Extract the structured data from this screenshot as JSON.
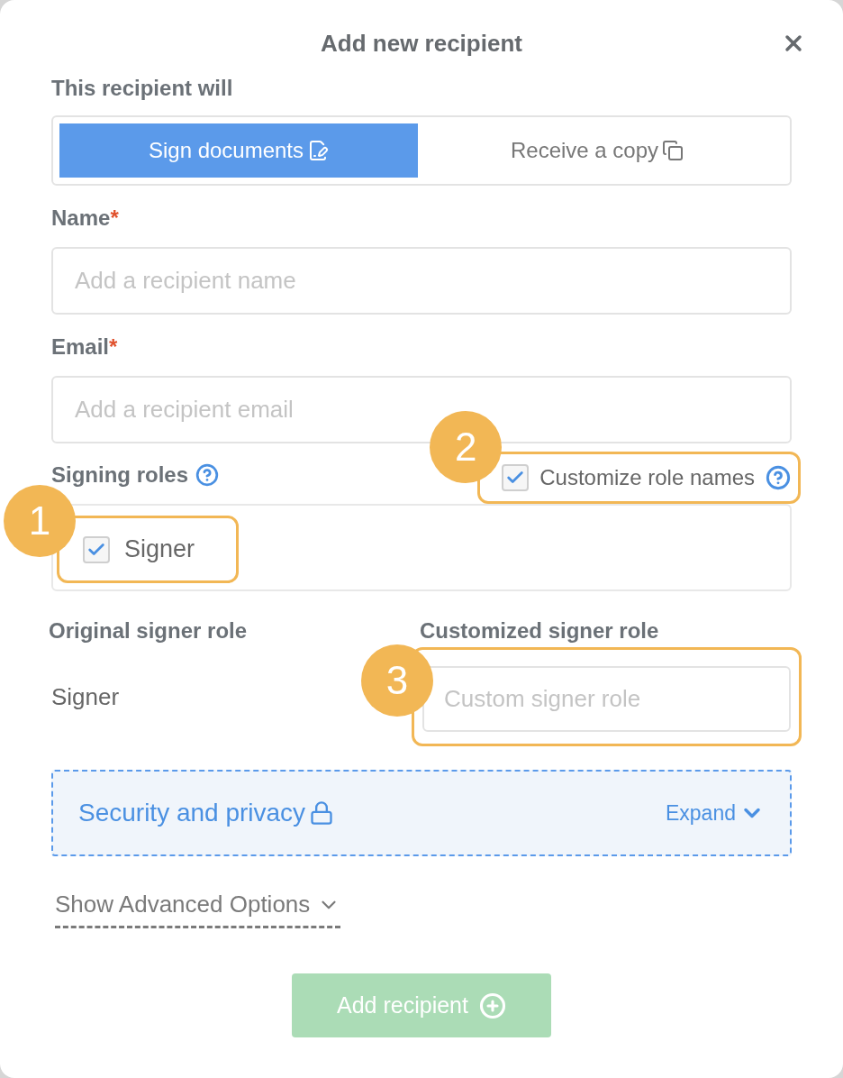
{
  "dialog": {
    "title": "Add new recipient"
  },
  "action": {
    "label": "This recipient will",
    "options": [
      {
        "label": "Sign documents",
        "kind": "sign",
        "selected": true
      },
      {
        "label": "Receive a copy",
        "kind": "copy",
        "selected": false
      }
    ]
  },
  "fields": [
    {
      "label": "Name",
      "marker": "*",
      "placeholder": "Add a recipient name"
    },
    {
      "label": "Email",
      "marker": "*",
      "placeholder": "Add a recipient email"
    }
  ],
  "signing_roles": {
    "label": "Signing roles",
    "customize": {
      "label": "Customize role names",
      "checked": true
    },
    "roles": [
      {
        "label": "Signer",
        "checked": true
      }
    ]
  },
  "role_mapping": {
    "original_heading": "Original signer role",
    "custom_heading": "Customized signer role",
    "rows": [
      {
        "original": "Signer",
        "placeholder": "Custom signer role"
      }
    ]
  },
  "security": {
    "label": "Security and privacy",
    "toggle": "Expand",
    "expanded": false
  },
  "advanced": {
    "label": "Show Advanced Options",
    "expanded": false
  },
  "submit": {
    "label": "Add recipient",
    "disabled": true
  },
  "callouts": [
    {
      "number": "1"
    },
    {
      "number": "2"
    },
    {
      "number": "3"
    }
  ]
}
